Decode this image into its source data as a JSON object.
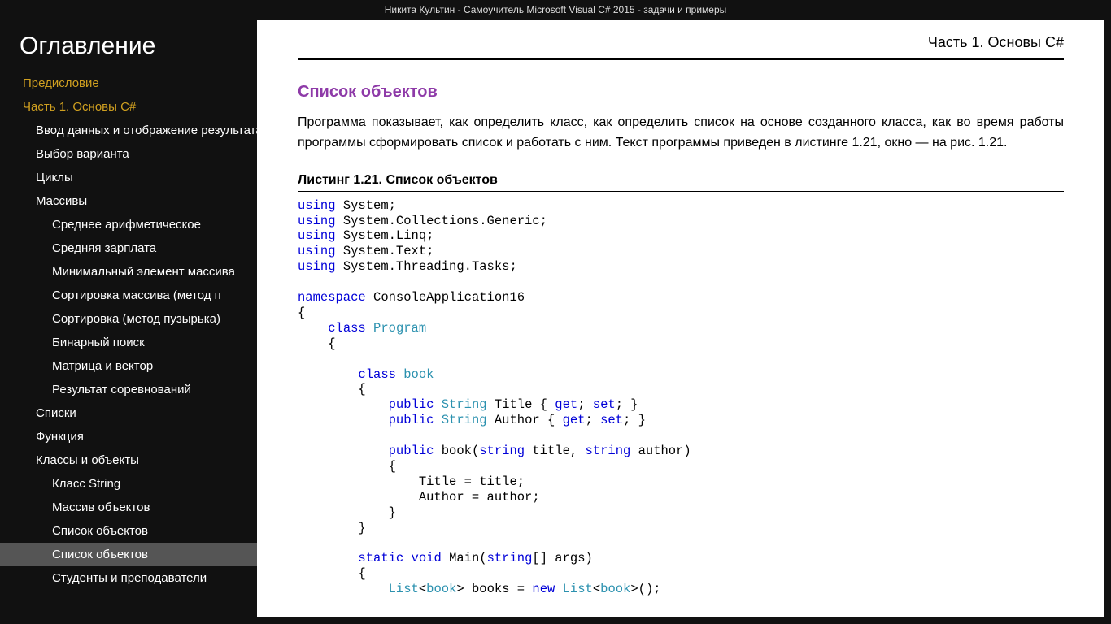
{
  "window": {
    "title": "Никита Культин - Самоучитель Microsoft Visual C# 2015 - задачи и примеры"
  },
  "sidebar": {
    "heading": "Оглавление",
    "items": [
      {
        "label": "Предисловие",
        "level": 1,
        "accent": true
      },
      {
        "label": "Часть 1. Основы C#",
        "level": 1,
        "accent": true
      },
      {
        "label": "Ввод данных и отображение результата",
        "level": 2
      },
      {
        "label": "Выбор варианта",
        "level": 2
      },
      {
        "label": "Циклы",
        "level": 2
      },
      {
        "label": "Массивы",
        "level": 2
      },
      {
        "label": "Среднее арифметическое",
        "level": 3
      },
      {
        "label": "Средняя зарплата",
        "level": 3
      },
      {
        "label": "Минимальный элемент массива",
        "level": 3
      },
      {
        "label": "Сортировка массива (метод п",
        "level": 3
      },
      {
        "label": "Сортировка (метод пузырька)",
        "level": 3
      },
      {
        "label": "Бинарный поиск",
        "level": 3
      },
      {
        "label": "Матрица и вектор",
        "level": 3
      },
      {
        "label": "Результат соревнований",
        "level": 3
      },
      {
        "label": "Списки",
        "level": 2
      },
      {
        "label": "Функция",
        "level": 2
      },
      {
        "label": "Классы и объекты",
        "level": 2
      },
      {
        "label": "Класс String",
        "level": 3
      },
      {
        "label": "Массив объектов",
        "level": 3
      },
      {
        "label": "Список объектов",
        "level": 3
      },
      {
        "label": "Список объектов",
        "level": 3,
        "selected": true
      },
      {
        "label": "Студенты и преподаватели",
        "level": 3
      }
    ]
  },
  "content": {
    "chapter": "Часть 1. Основы C#",
    "section_title": "Список объектов",
    "paragraph": "Программа показывает, как определить класс, как определить список на основе созданного класса, как во время работы программы сформировать список и работать с ним. Текст программы приведен в листинге 1.21, окно — на рис. 1.21.",
    "listing_title": "Листинг 1.21. Список объектов",
    "code_tokens": [
      [
        "kw",
        "using"
      ],
      [
        "pln",
        " System;\n"
      ],
      [
        "kw",
        "using"
      ],
      [
        "pln",
        " System.Collections.Generic;\n"
      ],
      [
        "kw",
        "using"
      ],
      [
        "pln",
        " System.Linq;\n"
      ],
      [
        "kw",
        "using"
      ],
      [
        "pln",
        " System.Text;\n"
      ],
      [
        "kw",
        "using"
      ],
      [
        "pln",
        " System.Threading.Tasks;\n\n"
      ],
      [
        "kw",
        "namespace"
      ],
      [
        "pln",
        " ConsoleApplication16\n{\n    "
      ],
      [
        "kw",
        "class"
      ],
      [
        "pln",
        " "
      ],
      [
        "typ",
        "Program"
      ],
      [
        "pln",
        "\n    {\n\n        "
      ],
      [
        "kw",
        "class"
      ],
      [
        "pln",
        " "
      ],
      [
        "typ",
        "book"
      ],
      [
        "pln",
        "\n        {\n            "
      ],
      [
        "kw",
        "public"
      ],
      [
        "pln",
        " "
      ],
      [
        "typ",
        "String"
      ],
      [
        "pln",
        " Title { "
      ],
      [
        "kw",
        "get"
      ],
      [
        "pln",
        "; "
      ],
      [
        "kw",
        "set"
      ],
      [
        "pln",
        "; }\n            "
      ],
      [
        "kw",
        "public"
      ],
      [
        "pln",
        " "
      ],
      [
        "typ",
        "String"
      ],
      [
        "pln",
        " Author { "
      ],
      [
        "kw",
        "get"
      ],
      [
        "pln",
        "; "
      ],
      [
        "kw",
        "set"
      ],
      [
        "pln",
        "; }\n\n            "
      ],
      [
        "kw",
        "public"
      ],
      [
        "pln",
        " book("
      ],
      [
        "kw",
        "string"
      ],
      [
        "pln",
        " title, "
      ],
      [
        "kw",
        "string"
      ],
      [
        "pln",
        " author)\n            {\n                Title = title;\n                Author = author;\n            }\n        }\n\n        "
      ],
      [
        "kw",
        "static"
      ],
      [
        "pln",
        " "
      ],
      [
        "kw",
        "void"
      ],
      [
        "pln",
        " Main("
      ],
      [
        "kw",
        "string"
      ],
      [
        "pln",
        "[] args)\n        {\n            "
      ],
      [
        "typ",
        "List"
      ],
      [
        "pln",
        "<"
      ],
      [
        "typ",
        "book"
      ],
      [
        "pln",
        "> books = "
      ],
      [
        "kw",
        "new"
      ],
      [
        "pln",
        " "
      ],
      [
        "typ",
        "List"
      ],
      [
        "pln",
        "<"
      ],
      [
        "typ",
        "book"
      ],
      [
        "pln",
        ">();\n"
      ]
    ]
  }
}
